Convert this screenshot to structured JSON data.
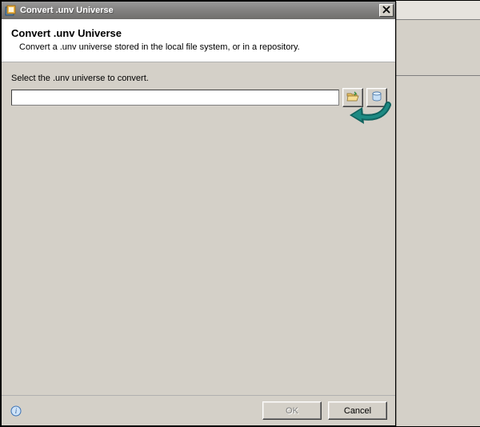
{
  "window": {
    "title": "Convert .unv Universe"
  },
  "header": {
    "title": "Convert .unv Universe",
    "description": "Convert a .unv universe stored in the local file system, or in a repository."
  },
  "body": {
    "prompt": "Select the .unv universe to convert.",
    "path_value": "",
    "browse_local_tooltip": "Browse local file system",
    "browse_repo_tooltip": "Browse repository"
  },
  "footer": {
    "ok_label": "OK",
    "cancel_label": "Cancel"
  }
}
